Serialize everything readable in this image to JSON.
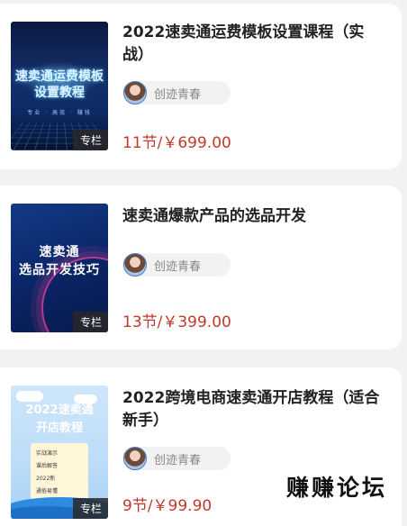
{
  "courses": [
    {
      "thumb_title_line1": "速卖通运费模板",
      "thumb_title_line2": "设置教程",
      "thumb_sub": "专业 · 高效 · 赚钱",
      "tag": "专栏",
      "title": "2022速卖通运费模板设置课程（实战）",
      "author": "创迹青春",
      "price": "11节/￥699.00"
    },
    {
      "thumb_title_line1": "速卖通",
      "thumb_title_line2": "选品开发技巧",
      "tag": "专栏",
      "title": "速卖通爆款产品的选品开发",
      "author": "创迹青春",
      "price": "13节/￥399.00"
    },
    {
      "thumb_title_line1": "2022速卖通",
      "thumb_title_line2": "开店教程",
      "thumb_points": [
        "实战演示",
        "课后解答",
        "2022新",
        "通俗易懂"
      ],
      "tag": "专栏",
      "title": "2022跨境电商速卖通开店教程（适合新手）",
      "author": "创迹青春",
      "price": "9节/￥99.90"
    }
  ],
  "watermark": "赚赚论坛",
  "colors": {
    "price": "#c0392b",
    "background": "#f2f2f2",
    "card": "#ffffff"
  }
}
